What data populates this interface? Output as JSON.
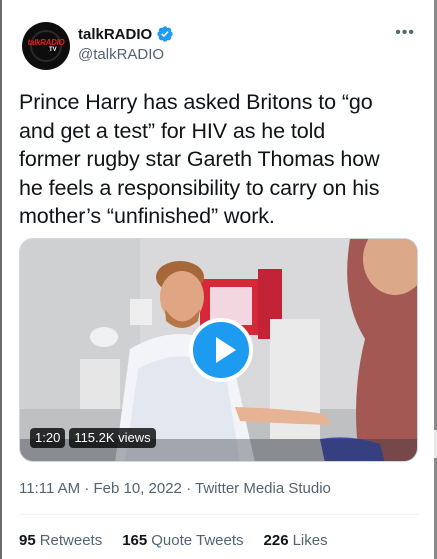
{
  "account": {
    "display_name": "talkRADIO",
    "handle": "@talkRADIO",
    "verified": true,
    "avatar_logo_main": "talkRADIO",
    "avatar_logo_sub": "TV"
  },
  "tweet": {
    "text": "Prince Harry has asked Britons to “go\nand get a test” for HIV as he told\nformer rugby star Gareth Thomas how\nhe feels a responsibility to carry on his\nmother’s “unfinished” work."
  },
  "media": {
    "duration": "1:20",
    "views": "115.2K views"
  },
  "meta": {
    "time": "11:11 AM",
    "separator": "·",
    "date": "Feb 10, 2022",
    "source": "Twitter Media Studio"
  },
  "stats": {
    "retweets_count": "95",
    "retweets_label": "Retweets",
    "quotes_count": "165",
    "quotes_label": "Quote Tweets",
    "likes_count": "226",
    "likes_label": "Likes"
  },
  "colors": {
    "accent": "#1d9bf0",
    "text": "#0f1419",
    "muted": "#536471"
  },
  "icons": [
    "verified-badge-icon",
    "more-icon",
    "play-icon"
  ]
}
